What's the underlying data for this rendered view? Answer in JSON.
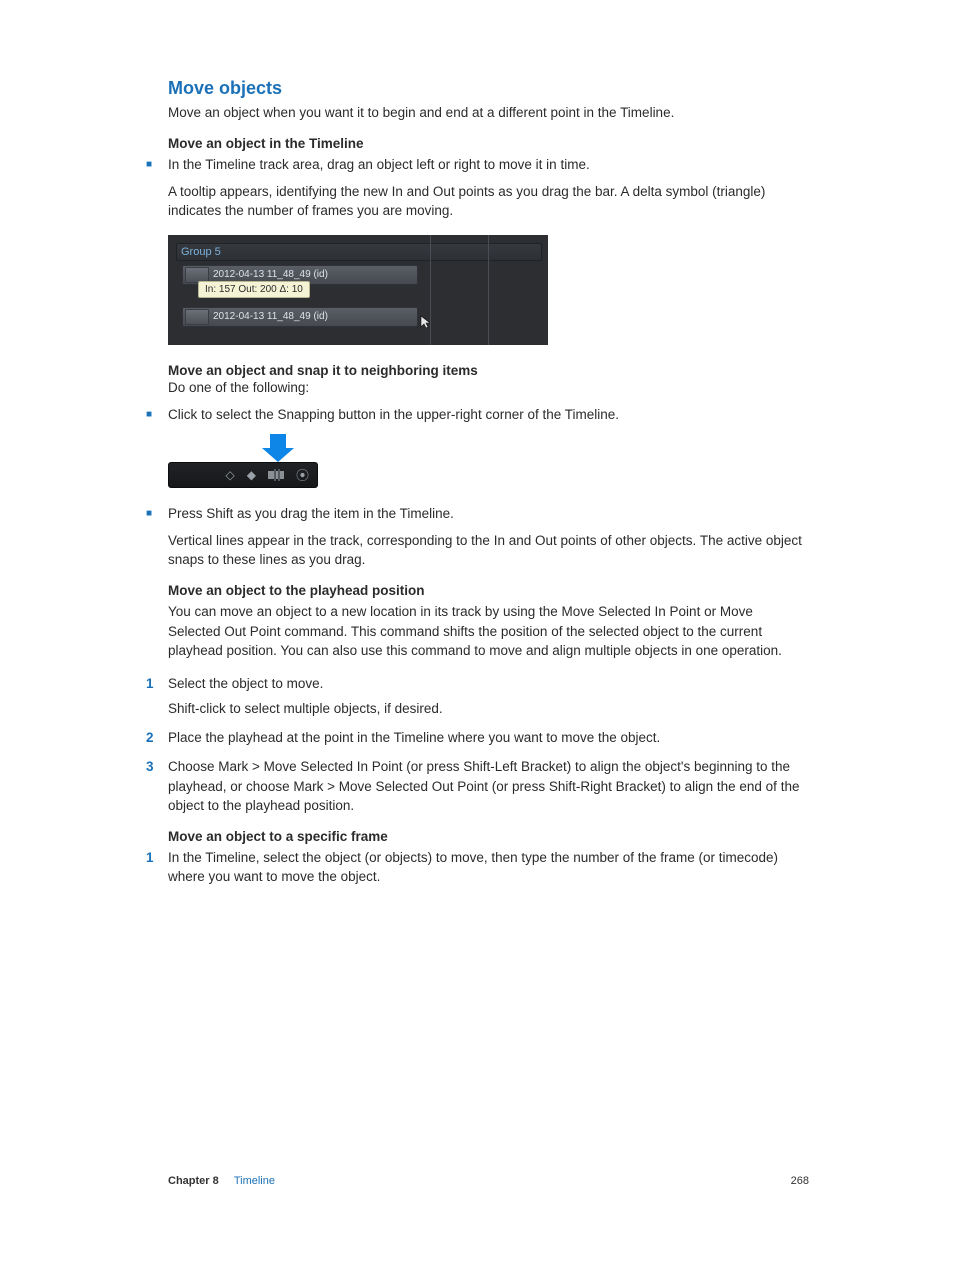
{
  "title": "Move objects",
  "intro": "Move an object when you want it to begin and end at a different point in the Timeline.",
  "sec1": {
    "heading": "Move an object in the Timeline",
    "bullet1": "In the Timeline track area, drag an object left or right to move it in time.",
    "para1": "A tooltip appears, identifying the new In and Out points as you drag the bar. A delta symbol (triangle) indicates the number of frames you are moving."
  },
  "fig1": {
    "group": "Group 5",
    "clip1_label": "2012-04-13 11_48_49 (id)",
    "tooltip": "In: 157 Out: 200 Δ: 10",
    "clip2_label": "2012-04-13 11_48_49 (id)"
  },
  "sec2": {
    "heading": "Move an object and snap it to neighboring items",
    "lead": "Do one of the following:",
    "bullet1": "Click to select the Snapping button in the upper-right corner of the Timeline.",
    "bullet2": "Press Shift as you drag the item in the Timeline.",
    "para2": "Vertical lines appear in the track, corresponding to the In and Out points of other objects. The active object snaps to these lines as you drag."
  },
  "sec3": {
    "heading": "Move an object to the playhead position",
    "para1": "You can move an object to a new location in its track by using the Move Selected In Point or Move Selected Out Point command. This command shifts the position of the selected object to the current playhead position. You can also use this command to move and align multiple objects in one operation.",
    "step1": "Select the object to move.",
    "step1_sub": "Shift-click to select multiple objects, if desired.",
    "step2": "Place the playhead at the point in the Timeline where you want to move the object.",
    "step3": "Choose Mark > Move Selected In Point (or press Shift-Left Bracket) to align the object's beginning to the playhead, or choose Mark > Move Selected Out Point (or press Shift-Right Bracket) to align the end of the object to the playhead position."
  },
  "sec4": {
    "heading": "Move an object to a specific frame",
    "step1": "In the Timeline, select the object (or objects) to move, then type the number of the frame (or timecode) where you want to move the object."
  },
  "footer": {
    "chapter_label": "Chapter 8",
    "chapter_name": "Timeline",
    "page": "268"
  },
  "markers": {
    "bullet": "■",
    "n1": "1",
    "n2": "2",
    "n3": "3"
  }
}
